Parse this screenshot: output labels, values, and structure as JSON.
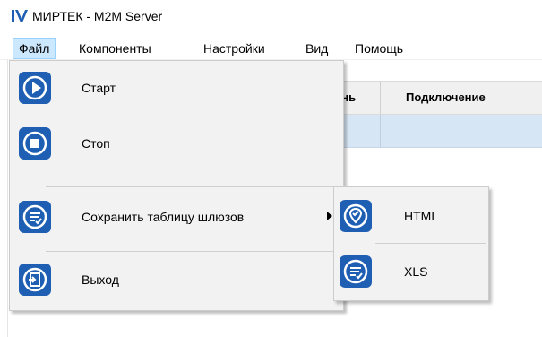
{
  "window": {
    "title": "МИРТЕК - M2M Server",
    "logo_icon": "mirtek-logo-icon",
    "accent_color": "#1f5fb3"
  },
  "menubar": {
    "items": [
      {
        "label": "Файл",
        "state": "open"
      },
      {
        "label": "Компоненты"
      },
      {
        "label": "Настройки"
      },
      {
        "label": "Вид"
      },
      {
        "label": "Помощь"
      }
    ]
  },
  "table": {
    "headers": [
      "ень",
      "Подключение"
    ],
    "row_selected": true
  },
  "file_menu": {
    "items": [
      {
        "label": "Старт",
        "icon": "play-icon"
      },
      {
        "label": "Стоп",
        "icon": "stop-icon"
      },
      {
        "label": "Сохранить таблицу шлюзов",
        "icon": "save-list-icon",
        "has_submenu": true
      },
      {
        "label": "Выход",
        "icon": "exit-icon"
      }
    ]
  },
  "save_submenu": {
    "items": [
      {
        "label": "HTML",
        "icon": "location-check-icon"
      },
      {
        "label": "XLS",
        "icon": "list-edit-icon"
      }
    ]
  }
}
